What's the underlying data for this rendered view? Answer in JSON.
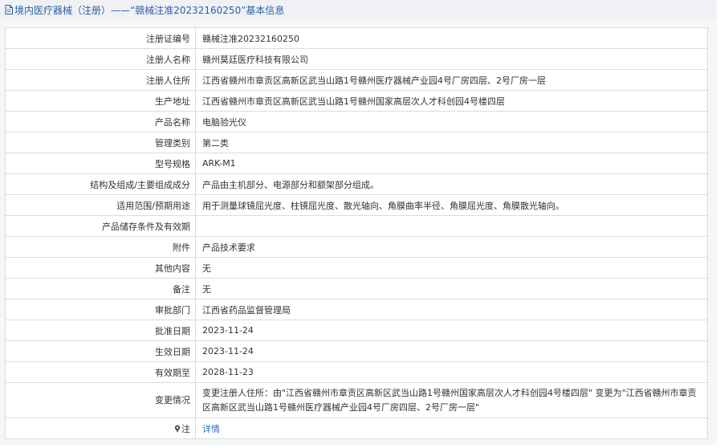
{
  "header": {
    "title": "境内医疗器械（注册）——“赣械注准20232160250”基本信息"
  },
  "rows": [
    {
      "label": "注册证编号",
      "value": "赣械注准20232160250"
    },
    {
      "label": "注册人名称",
      "value": "赣州莫廷医疗科技有限公司"
    },
    {
      "label": "注册人住所",
      "value": "江西省赣州市章贡区高新区武当山路1号赣州医疗器械产业园4号厂房四层、2号厂房一层"
    },
    {
      "label": "生产地址",
      "value": "江西省赣州市章贡区高新区武当山路1号赣州国家高层次人才科创园4号楼四层"
    },
    {
      "label": "产品名称",
      "value": "电脑验光仪"
    },
    {
      "label": "管理类别",
      "value": "第二类"
    },
    {
      "label": "型号规格",
      "value": "ARK-M1"
    },
    {
      "label": "结构及组成/主要组成成分",
      "value": "产品由主机部分、电源部分和额架部分组成。"
    },
    {
      "label": "适用范围/预期用途",
      "value": "用于测量球镜屈光度、柱镜屈光度、散光轴向、角膜曲率半径、角膜屈光度、角膜散光轴向。"
    },
    {
      "label": "产品储存条件及有效期",
      "value": ""
    },
    {
      "label": "附件",
      "value": "产品技术要求"
    },
    {
      "label": "其他内容",
      "value": "无"
    },
    {
      "label": "备注",
      "value": "无"
    },
    {
      "label": "审批部门",
      "value": "江西省药品监督管理局"
    },
    {
      "label": "批准日期",
      "value": "2023-11-24"
    },
    {
      "label": "生效日期",
      "value": "2023-11-24"
    },
    {
      "label": "有效期至",
      "value": "2028-11-23"
    },
    {
      "label": "变更情况",
      "value": "变更注册人住所：由\"江西省赣州市章贡区高新区武当山路1号赣州国家高层次人才科创园4号楼四层\" 变更为\"江西省赣州市章贡区高新区武当山路1号赣州医疗器械产业园4号厂房四层、2号厂房一层\""
    }
  ],
  "note": {
    "label": "注",
    "icon": "pin-icon",
    "link": "详情"
  },
  "colors": {
    "header_bg": "#f0f1f5",
    "title_text": "#2a5fa8",
    "link": "#2a6bd1",
    "border": "#dcdcdc"
  }
}
